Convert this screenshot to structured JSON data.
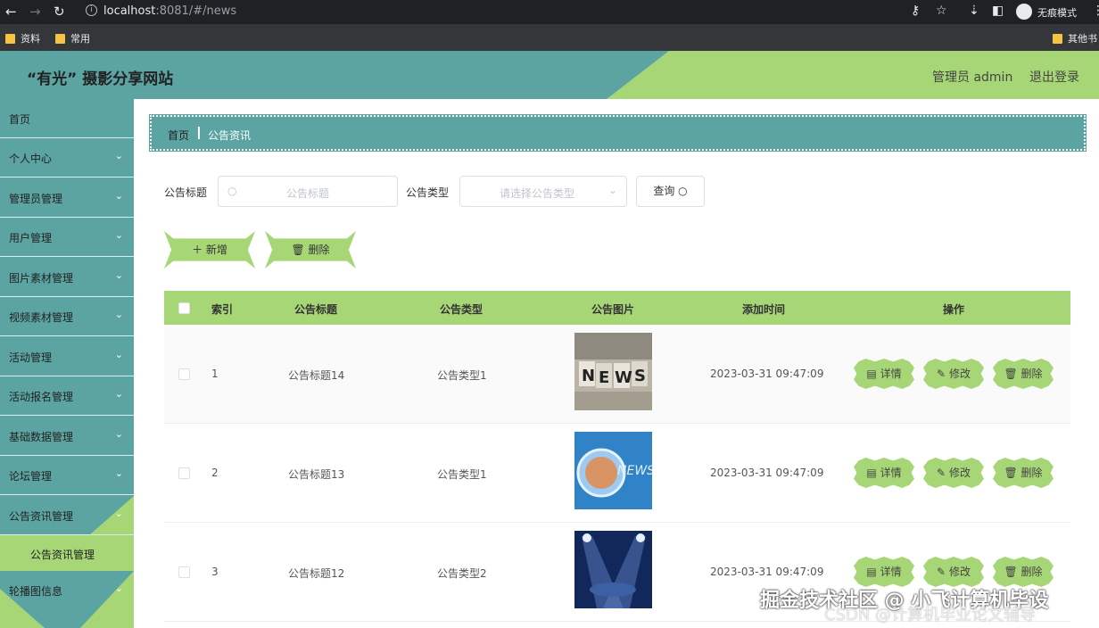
{
  "browser": {
    "url_host": "localhost",
    "url_rest": ":8081/#/news",
    "incognito_label": "无痕模式",
    "bookmarks": [
      "资料",
      "常用"
    ],
    "other_bookmarks": "其他书"
  },
  "header": {
    "title": "“有光” 摄影分享网站",
    "user": "管理员 admin",
    "logout": "退出登录"
  },
  "sidebar": {
    "items": [
      {
        "label": "首页",
        "has_chevron": false
      },
      {
        "label": "个人中心",
        "has_chevron": true
      },
      {
        "label": "管理员管理",
        "has_chevron": true
      },
      {
        "label": "用户管理",
        "has_chevron": true
      },
      {
        "label": "图片素材管理",
        "has_chevron": true
      },
      {
        "label": "视频素材管理",
        "has_chevron": true
      },
      {
        "label": "活动管理",
        "has_chevron": true
      },
      {
        "label": "活动报名管理",
        "has_chevron": true
      },
      {
        "label": "基础数据管理",
        "has_chevron": true
      },
      {
        "label": "论坛管理",
        "has_chevron": true
      },
      {
        "label": "公告资讯管理",
        "has_chevron": true,
        "expanded": true
      }
    ],
    "submenu_active": "公告资讯管理",
    "after_item": "轮播图信息"
  },
  "breadcrumb": {
    "home": "首页",
    "current": "公告资讯"
  },
  "search": {
    "title_label": "公告标题",
    "title_placeholder": "公告标题",
    "type_label": "公告类型",
    "type_placeholder": "请选择公告类型",
    "query_button": "查询"
  },
  "actions": {
    "add": "新增",
    "delete": "删除"
  },
  "table": {
    "columns": [
      "索引",
      "公告标题",
      "公告类型",
      "公告图片",
      "添加时间",
      "操作"
    ],
    "rows": [
      {
        "index": "1",
        "title": "公告标题14",
        "type": "公告类型1",
        "time": "2023-03-31 09:47:09",
        "image": "news-cubes"
      },
      {
        "index": "2",
        "title": "公告标题13",
        "type": "公告类型1",
        "time": "2023-03-31 09:47:09",
        "image": "news-globe"
      },
      {
        "index": "3",
        "title": "公告标题12",
        "type": "公告类型2",
        "time": "2023-03-31 09:47:09",
        "image": "news-spotlight"
      }
    ],
    "op_labels": {
      "detail": "详情",
      "edit": "修改",
      "delete": "删除"
    }
  },
  "watermark": {
    "line1": "掘金技术社区 @ 小飞计算机毕设",
    "line2": "CSDN @计算机毕业论文辅导"
  },
  "colors": {
    "teal": "#5ba4a1",
    "green": "#a6d676",
    "chrome": "#202124"
  }
}
